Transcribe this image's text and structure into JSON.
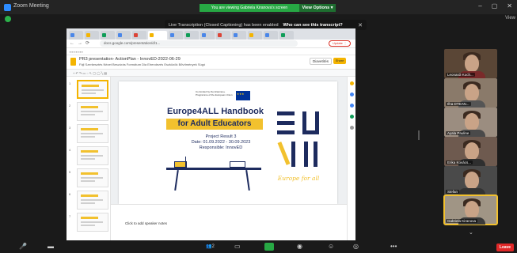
{
  "window": {
    "title": "Zoom Meeting",
    "controls": [
      "–",
      "▢",
      "✕"
    ],
    "view_label": "View"
  },
  "share_banner": {
    "text": "You are viewing Gabriela Kiranova's screen",
    "view_options": "View Options ▾",
    "color": "#27a844"
  },
  "transcript_notice": {
    "message": "Live Transcription (Closed Captioning) has been enabled",
    "ask": "Who can see this transcript?",
    "close": "✕"
  },
  "browser": {
    "url": "docs.google.com/presentation/d/1...",
    "update_label": "Update ⋮"
  },
  "slides_doc": {
    "title": "PR3 presentation- ActionPlan - InnovED-2022-06-29",
    "menu": "Fájl  Szerkesztés  Nézet  Beszúrás  Formátum  Dia  Elrendezés  Eszközök  Bővítmények  Súgó",
    "present_label": "Diavetítés",
    "share_label": "Share",
    "notes_text": "Click to add speaker notes"
  },
  "slide": {
    "eu_caption": "Co-funded by the Erasmus+ Programme of the European Union",
    "title_line1": "Europe4ALL Handbook",
    "title_line2": "for Adult Educators",
    "project_result": "Project Result 3",
    "date": "Date: 01.09.2022 - 30.09.2023",
    "responsible": "Responsible: InnovED",
    "script": "Europe for all",
    "accent_color": "#f2c12e",
    "navy_color": "#1d2b5e"
  },
  "participants": [
    {
      "name": "Leonardi Koch...",
      "shirt": "#7a2a2a",
      "bg": "#5a4636"
    },
    {
      "name": "Ilha DTEAN...",
      "shirt": "#555",
      "bg": "#8a7a6a"
    },
    {
      "name": "Ayala Pauline",
      "shirt": "#4a4a4a",
      "bg": "#9b8d80"
    },
    {
      "name": "Erika Kovács...",
      "shirt": "#2f2f2f",
      "bg": "#6e5a4f"
    },
    {
      "name": "Stefan",
      "shirt": "#333",
      "bg": "#4a4a4a"
    },
    {
      "name": "Gabriela Kiranova",
      "shirt": "#3a3a3a",
      "bg": "#a09585"
    }
  ],
  "toolbar": {
    "mic_icon": "mic-icon",
    "participants_count": "2",
    "leave_label": "Leave"
  }
}
